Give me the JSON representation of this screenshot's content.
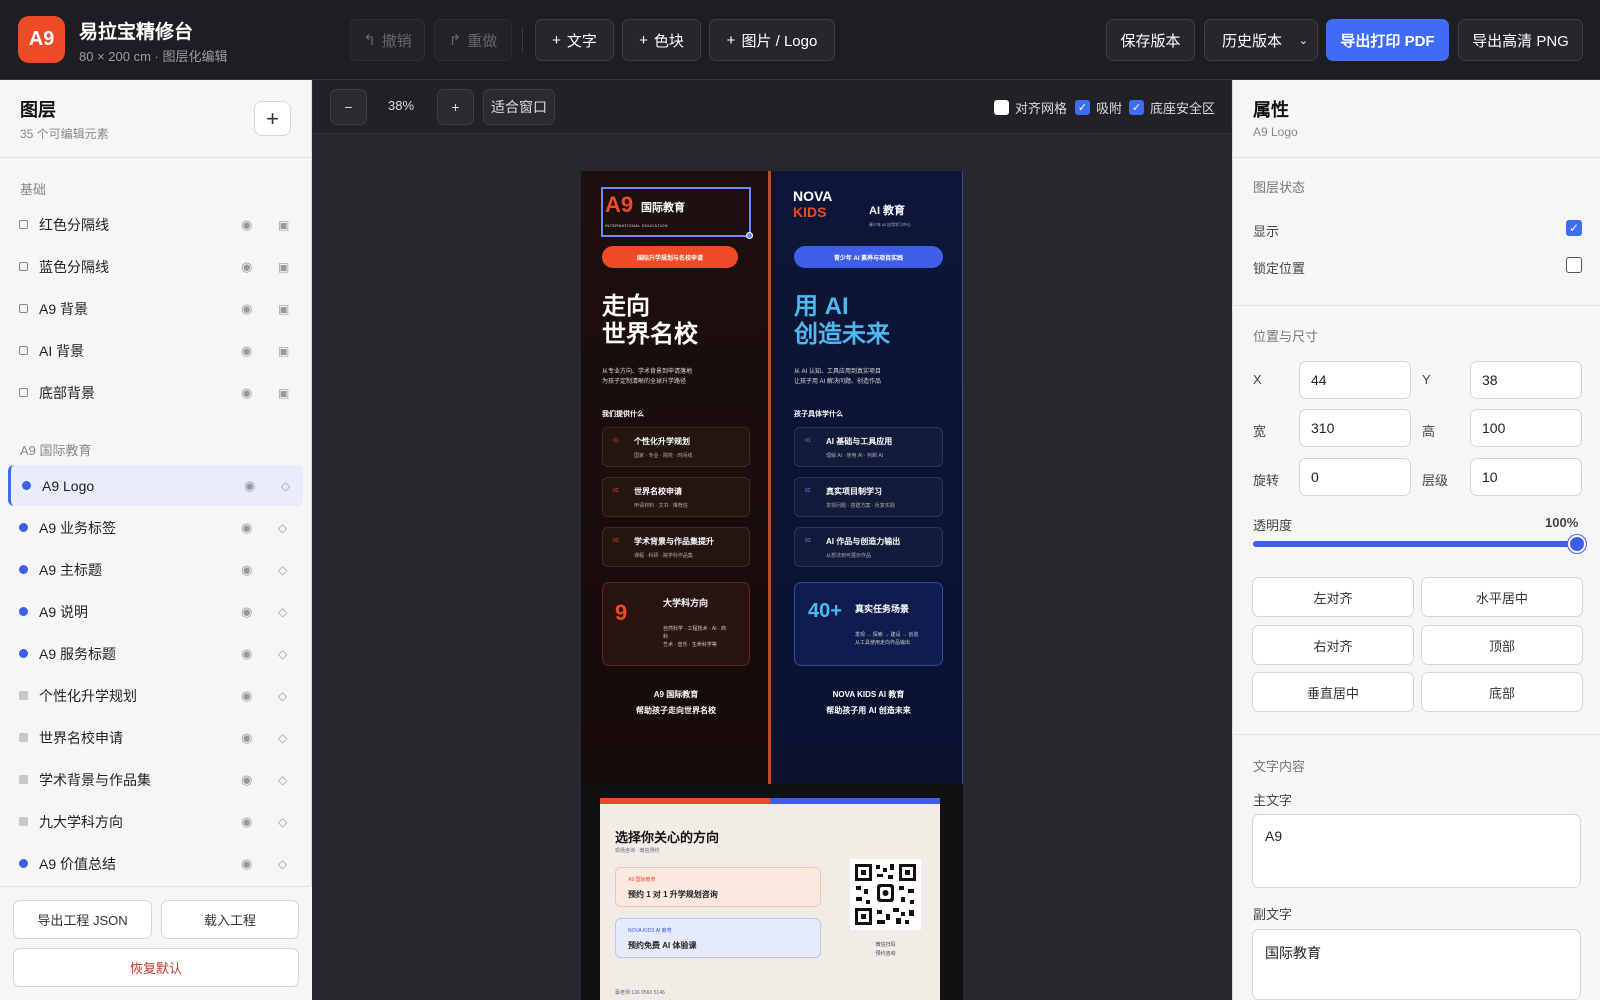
{
  "app": {
    "logo": "A9",
    "title": "易拉宝精修台",
    "subtitle": "80 × 200 cm · 图层化编辑"
  },
  "toolbar": {
    "undo": "撤销",
    "redo": "重做",
    "add_text": "文字",
    "add_color_block": "色块",
    "add_image": "图片 / Logo",
    "save_version": "保存版本",
    "history": "历史版本",
    "export_pdf": "导出打印 PDF",
    "export_png": "导出高清 PNG"
  },
  "layers_panel": {
    "title": "图层",
    "count": "35 个可编辑元素",
    "groups": [
      {
        "label": "基础",
        "items": [
          {
            "name": "红色分隔线"
          },
          {
            "name": "蓝色分隔线"
          },
          {
            "name": "A9 背景"
          },
          {
            "name": "AI 背景"
          },
          {
            "name": "底部背景"
          }
        ]
      },
      {
        "label": "A9 国际教育",
        "items": [
          {
            "name": "A9 Logo",
            "selected": true
          },
          {
            "name": "A9 业务标签"
          },
          {
            "name": "A9 主标题"
          },
          {
            "name": "A9 说明"
          },
          {
            "name": "A9 服务标题"
          },
          {
            "name": "个性化升学规划"
          },
          {
            "name": "世界名校申请"
          },
          {
            "name": "学术背景与作品集"
          },
          {
            "name": "九大学科方向"
          },
          {
            "name": "A9 价值总结"
          }
        ]
      }
    ],
    "footer": {
      "export_json": "导出工程 JSON",
      "load_project": "载入工程",
      "reset": "恢复默认"
    }
  },
  "canvas_toolbar": {
    "zoom_out": "−",
    "zoom": "38%",
    "zoom_in": "+",
    "fit": "适合窗口",
    "grid": {
      "label": "对齐网格",
      "checked": false
    },
    "snap": {
      "label": "吸附",
      "checked": true
    },
    "safe_area": {
      "label": "底座安全区",
      "checked": true
    }
  },
  "poster": {
    "a9": {
      "logo_mark": "A9",
      "logo_zh": "国际教育",
      "logo_en": "INTERNATIONAL EDUCATION",
      "tag": "国际升学规划与名校申请",
      "title_line1": "走向",
      "title_line2": "世界名校",
      "desc_line1": "从专业方向、学术背景到申请落地",
      "desc_line2": "为孩子定制清晰的全球升学路径",
      "section": "我们提供什么",
      "cards": [
        {
          "num": "01",
          "title": "个性化升学规划",
          "sub": "国家 · 专业 · 院校 · 时间线"
        },
        {
          "num": "02",
          "title": "世界名校申请",
          "sub": "申请材料 · 文书 · 推荐信"
        },
        {
          "num": "03",
          "title": "学术背景与作品集提升",
          "sub": "课程 · 科研 · 跨学科作品集"
        }
      ],
      "big_number": "9",
      "big_title": "大学科方向",
      "big_sub_line1": "自然科学 · 工程技术 · AI · 商",
      "big_sub_line2": "科",
      "big_sub_line3": "艺术 · 音乐 · 生命科学等",
      "footer_line1": "A9 国际教育",
      "footer_line2": "帮助孩子走向世界名校"
    },
    "ai": {
      "logo_line1": "NOVA",
      "logo_line2": "KIDS",
      "logo_title": "AI 教育",
      "logo_sub": "青少年 AI 应用学习中心",
      "tag": "青少年 AI 素养与项目实践",
      "title_line1": "用 AI",
      "title_line2": "创造未来",
      "desc_line1": "从 AI 认知、工具应用到真实项目",
      "desc_line2": "让孩子用 AI 解决问题、创造作品",
      "section": "孩子具体学什么",
      "cards": [
        {
          "num": "01",
          "title": "AI 基础与工具应用",
          "sub": "理解 AI · 使用 AI · 判断 AI"
        },
        {
          "num": "02",
          "title": "真实项目制学习",
          "sub": "发现问题 · 搭建方案 · 反复实践"
        },
        {
          "num": "03",
          "title": "AI 作品与创造力输出",
          "sub": "从想法到可展示作品"
        }
      ],
      "big_number": "40+",
      "big_title": "真实任务场景",
      "big_sub_line1": "发现 → 探索 → 建设 → 创造",
      "big_sub_line2": "从工具使用走向作品输出",
      "footer_line1": "NOVA KIDS AI 教育",
      "footer_line2": "帮助孩子用 AI 创造未来"
    },
    "bottom": {
      "title": "选择你关心的方向",
      "sub": "现场咨询 · 微信预约",
      "option_a_tag": "A9 国际教育",
      "option_a": "预约 1 对 1 升学规划咨询",
      "option_b_tag": "NOVA KIDS AI 教育",
      "option_b": "预约免费 AI 体验课",
      "qr_caption_line1": "微信扫码",
      "qr_caption_line2": "预约咨询",
      "contact": "蔡老师  136 0560 5146"
    }
  },
  "props": {
    "title": "属性",
    "target": "A9 Logo",
    "state_section": "图层状态",
    "visible_label": "显示",
    "visible": true,
    "lock_label": "锁定位置",
    "locked": false,
    "geom_section": "位置与尺寸",
    "x_label": "X",
    "x": "44",
    "y_label": "Y",
    "y": "38",
    "w_label": "宽",
    "w": "310",
    "h_label": "高",
    "h": "100",
    "rot_label": "旋转",
    "rot": "0",
    "z_label": "层级",
    "z": "10",
    "opacity_label": "透明度",
    "opacity": "100%",
    "opacity_value": 1.0,
    "align": [
      "左对齐",
      "水平居中",
      "右对齐",
      "顶部",
      "垂直居中",
      "底部"
    ],
    "text_section": "文字内容",
    "main_label": "主文字",
    "main_text": "A9",
    "sub_label": "副文字",
    "sub_text": "国际教育"
  },
  "colors": {
    "accent": "#3f6bf6",
    "brand_red": "#ef4a25",
    "topbar": "#1d1e22"
  }
}
